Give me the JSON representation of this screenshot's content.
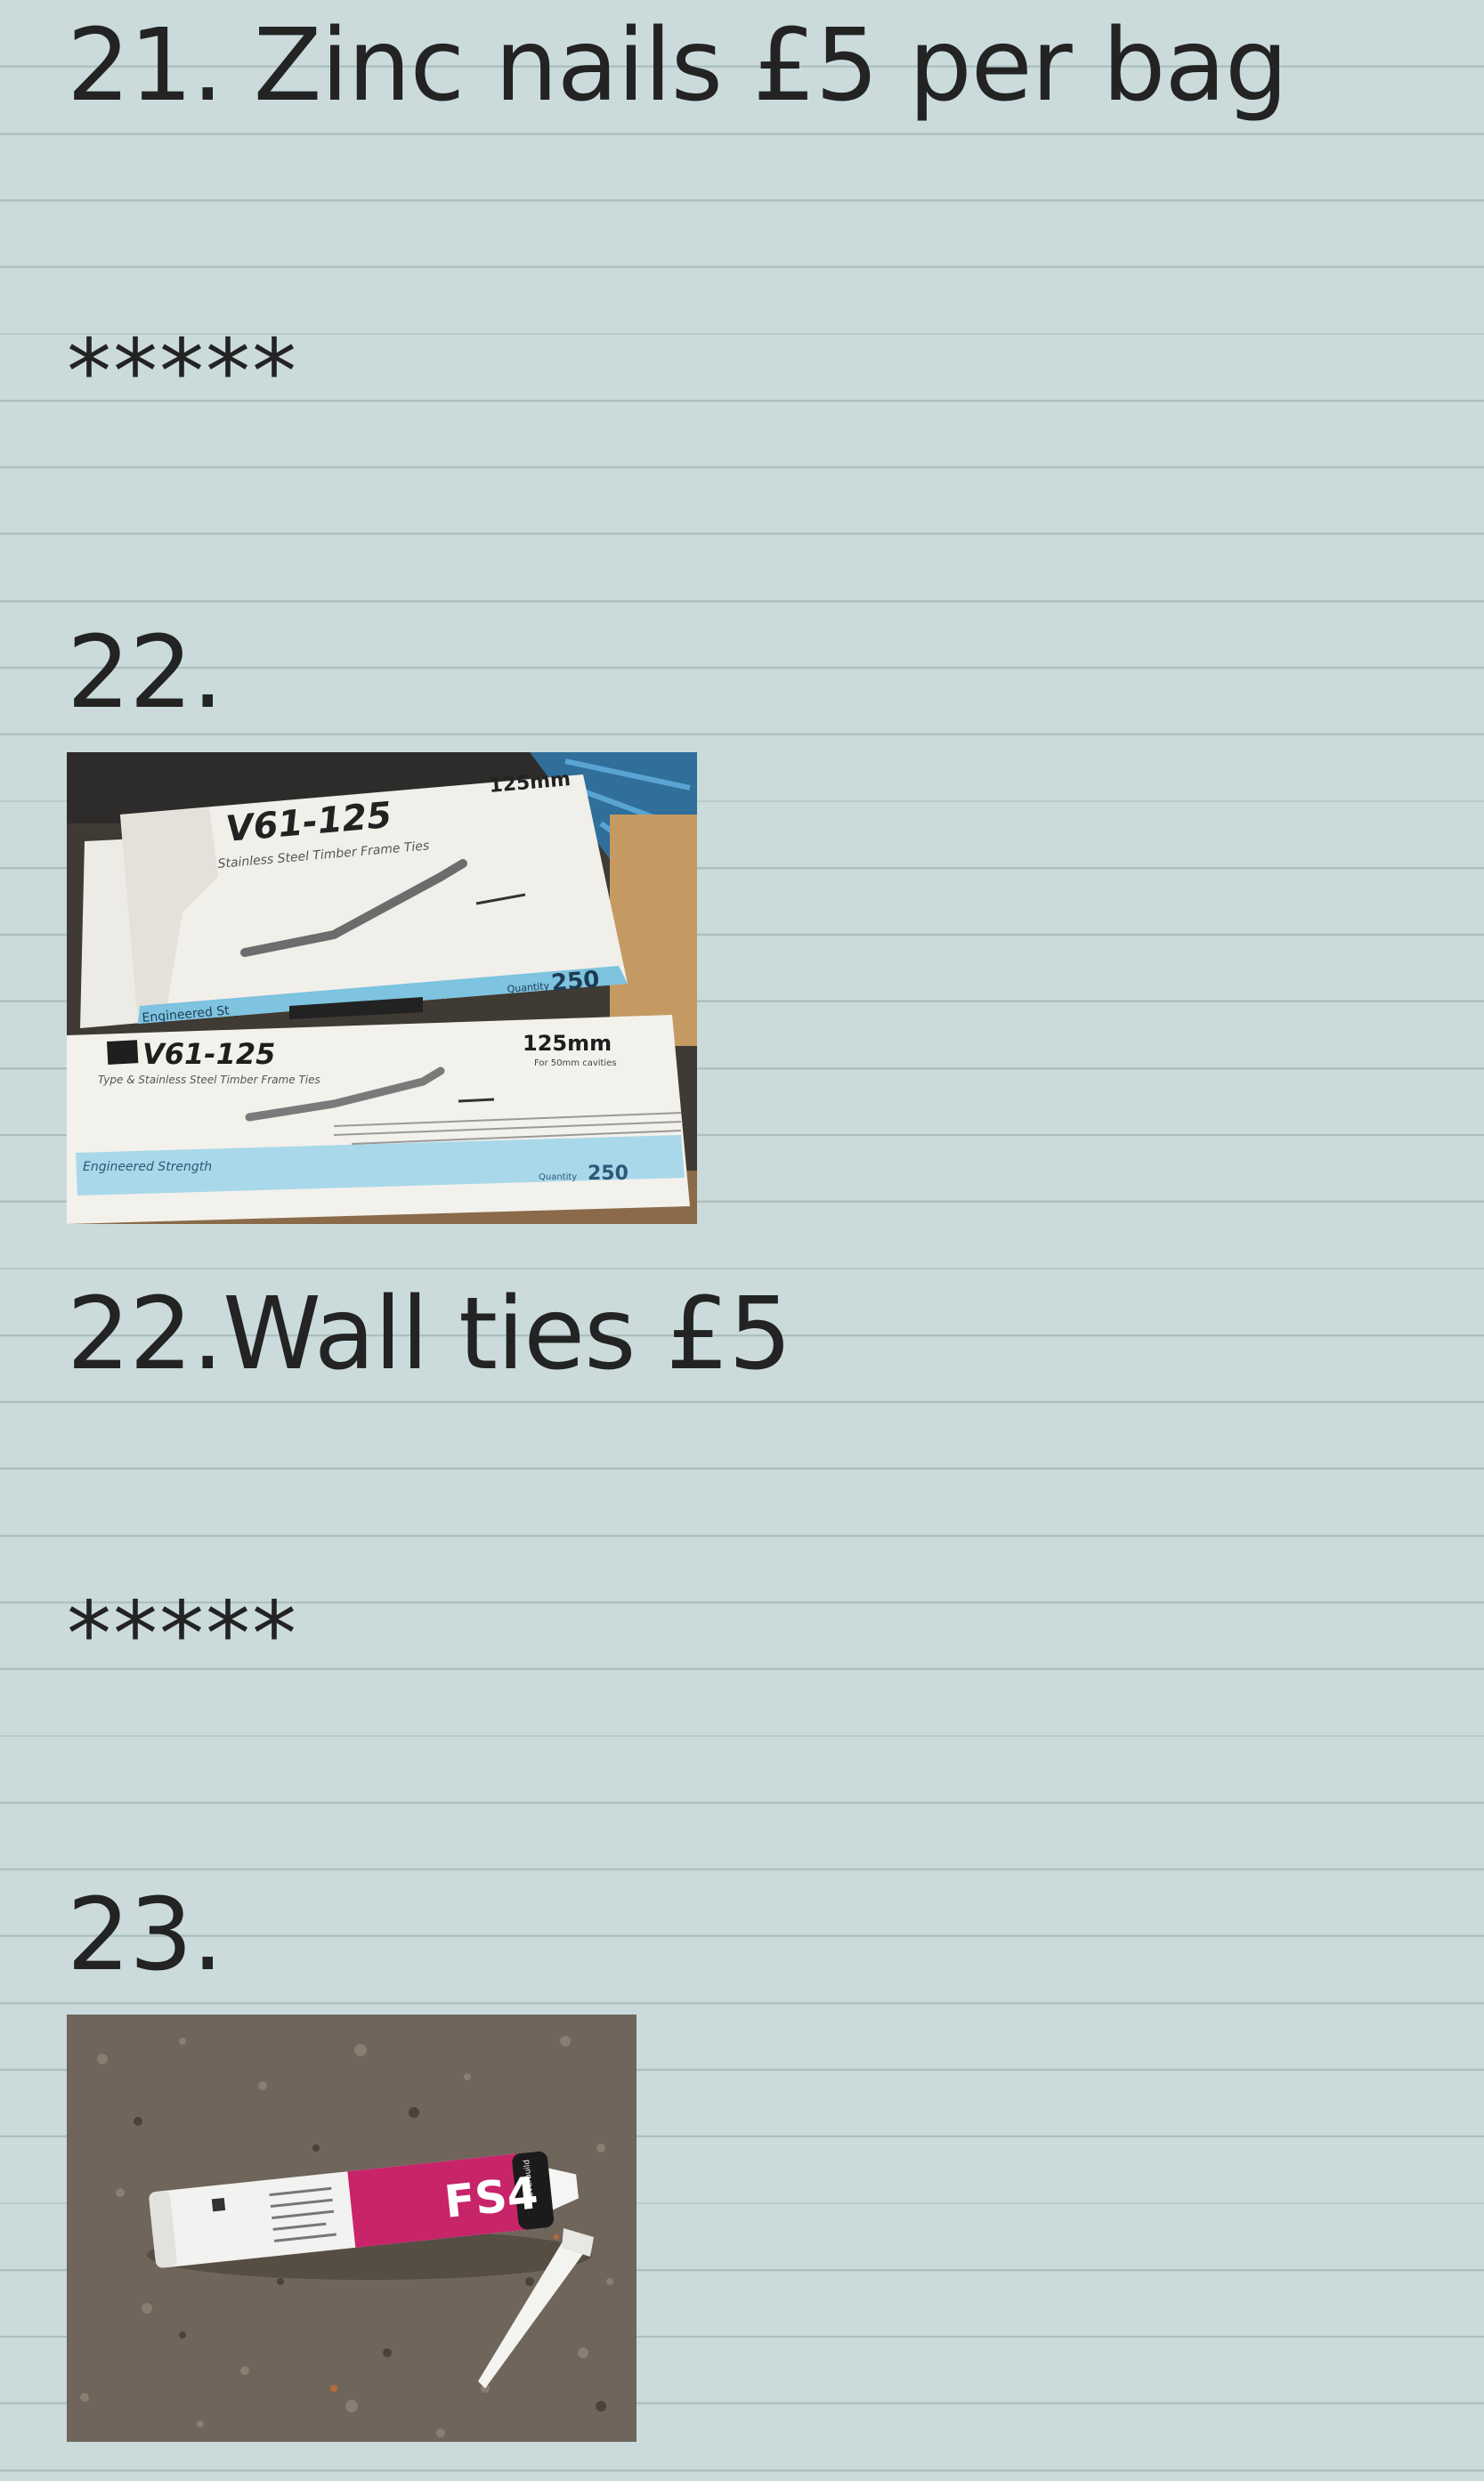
{
  "note": {
    "items": [
      {
        "heading": "21. Zinc nails £5 per bag",
        "separator": "*****"
      },
      {
        "heading": "22.",
        "photo": {
          "icon": "wall-ties-box-photo",
          "box_top": {
            "model": "V61-125",
            "subtitle": "Stainless Steel Timber Frame Ties",
            "size": "125mm",
            "quantity_label": "Quantity",
            "quantity": "250",
            "tagline": "Engineered St"
          },
          "box_bottom": {
            "model": "V61-125",
            "subtitle": "Type & Stainless Steel Timber Frame Ties",
            "size": "125mm",
            "size_note": "For 50mm cavities",
            "quantity_label": "Quantity",
            "quantity": "250",
            "tagline": "Engineered Strength"
          }
        },
        "caption": "22.Wall ties £5",
        "separator": "*****"
      },
      {
        "heading": "23.",
        "photo": {
          "icon": "sealant-tube-photo",
          "label": "FS4",
          "brand": "everbuild"
        }
      }
    ]
  },
  "colors": {
    "paper": "#cbdbdb",
    "rule": "#a9bcbc",
    "text": "#232323",
    "box_blue": "#7ec3df",
    "tube_pink": "#c8246a"
  }
}
